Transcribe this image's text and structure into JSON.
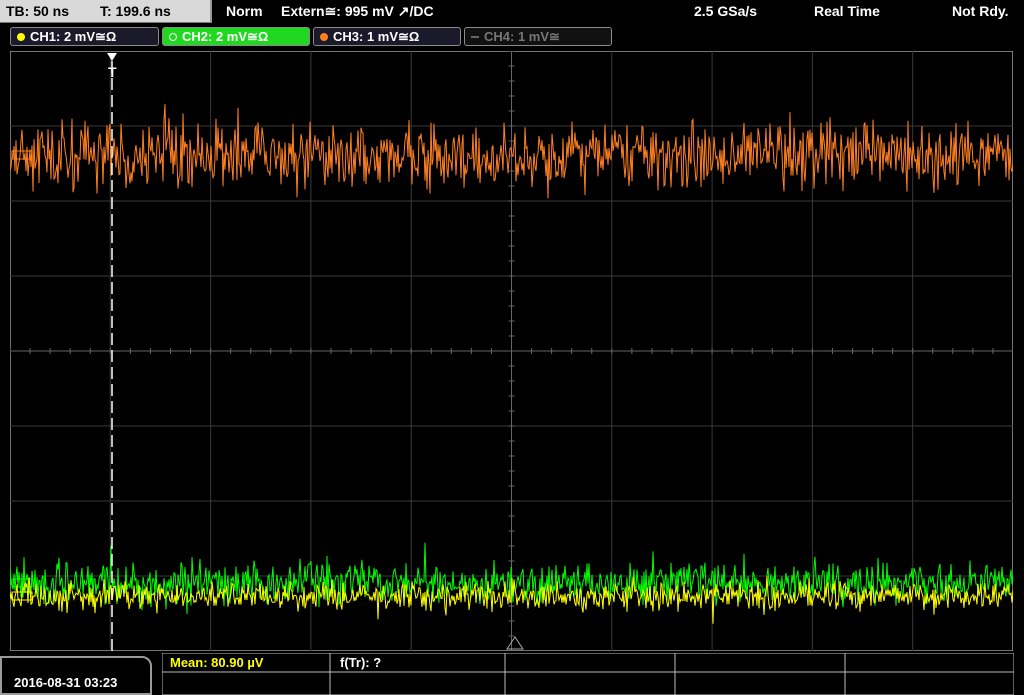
{
  "status": {
    "timebase": "TB: 50 ns",
    "trigger_time": "T: 199.6 ns",
    "mode": "Norm",
    "trigger_source": "Extern≅: 995 mV ↗/DC",
    "sample_rate": "2.5 GSa/s",
    "acquisition": "Real Time",
    "state": "Not Rdy."
  },
  "channels": [
    {
      "label": "CH1: 2 mV≅Ω",
      "color": "#ffff00",
      "active": true
    },
    {
      "label": "CH2: 2 mV≅Ω",
      "color": "#00ff00",
      "active": true,
      "selected": true
    },
    {
      "label": "CH3: 1 mV≅Ω",
      "color": "#ff8020",
      "active": true
    },
    {
      "label": "CH4: 1 mV≅",
      "color": "#777777",
      "active": false
    }
  ],
  "trigger_marker": "T",
  "footer": {
    "datetime": "2016-08-31 03:23",
    "measurement_mean": "Mean: 80.90 µV",
    "measurement_freq": "f(Tr): ?"
  },
  "chart_data": {
    "type": "line",
    "grid": true,
    "divisions_x": 10,
    "divisions_y": 8,
    "series": [
      {
        "name": "CH3",
        "color": "#ff8020"
      },
      {
        "name": "CH2",
        "color": "#00ff00"
      },
      {
        "name": "CH1",
        "color": "#ffff00"
      }
    ]
  }
}
